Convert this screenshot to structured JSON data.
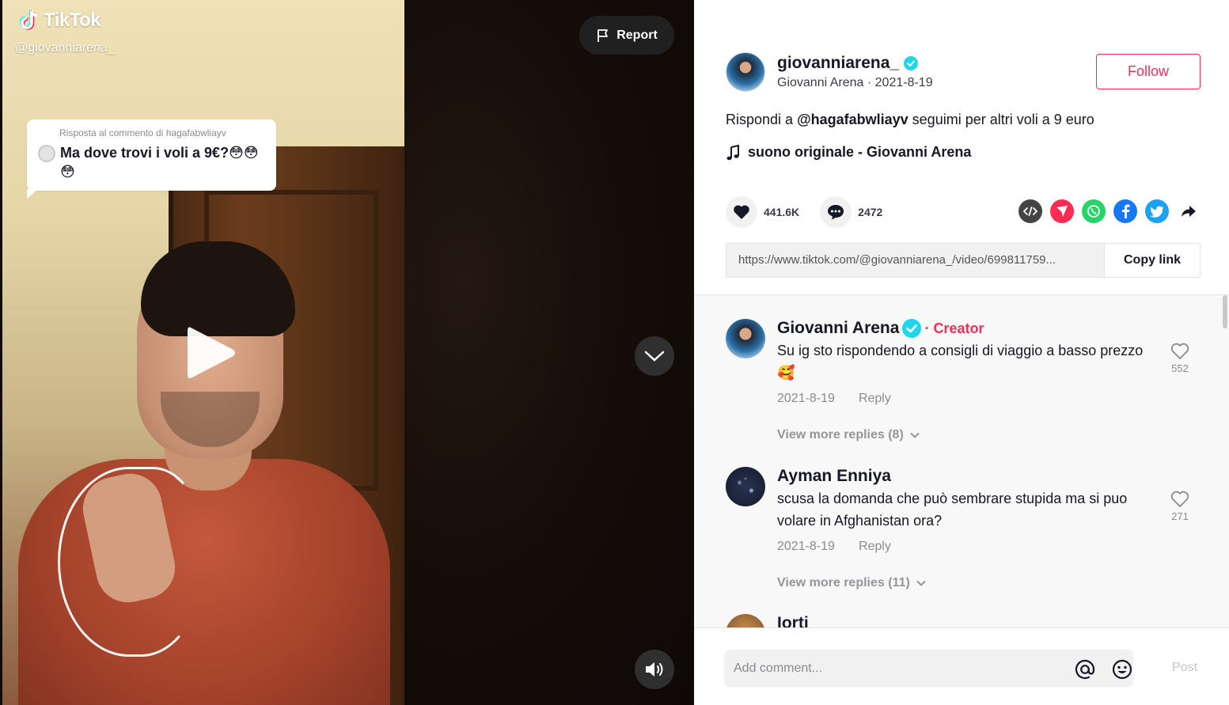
{
  "video": {
    "brand": "TikTok",
    "handle": "@giovanniarena_",
    "reply_header": "Risposta al commento di hagafabwliayv",
    "reply_text": "Ma dove trovi i voli a 9€?😳😳😳",
    "report_label": "Report"
  },
  "author": {
    "username": "giovanniarena_",
    "nickname": "Giovanni Arena",
    "date": "2021-8-19",
    "follow_label": "Follow"
  },
  "description": {
    "prefix": "Rispondi a ",
    "mention": "@hagafabwliayv",
    "text": " seguimi per altri voli a 9 euro"
  },
  "music": "suono originale - Giovanni Arena",
  "stats": {
    "likes": "441.6K",
    "comments": "2472"
  },
  "share_icons": [
    "embed-icon",
    "send-icon",
    "whatsapp-icon",
    "facebook-icon",
    "twitter-icon",
    "share-arrow-icon"
  ],
  "link": {
    "url": "https://www.tiktok.com/@giovanniarena_/video/699811759...",
    "copy_label": "Copy link"
  },
  "comments": [
    {
      "name": "Giovanni Arena",
      "creator_label": "Creator",
      "text": "Su ig sto rispondendo a consigli di viaggio a basso prezzo 🥰",
      "date": "2021-8-19",
      "reply_label": "Reply",
      "likes": "552",
      "more_replies": "View more replies (8)"
    },
    {
      "name": "Ayman Enniya",
      "text": "scusa la domanda che può sembrare stupida ma si puo volare in Afghanistan ora?",
      "date": "2021-8-19",
      "reply_label": "Reply",
      "likes": "271",
      "more_replies": "View more replies (11)"
    },
    {
      "name": "Iorti"
    }
  ],
  "comment_bar": {
    "placeholder": "Add comment...",
    "post_label": "Post"
  },
  "colors": {
    "accent": "#fe2c55",
    "verified": "#20d5ec",
    "text": "#161823",
    "muted": "#8a8b91"
  }
}
